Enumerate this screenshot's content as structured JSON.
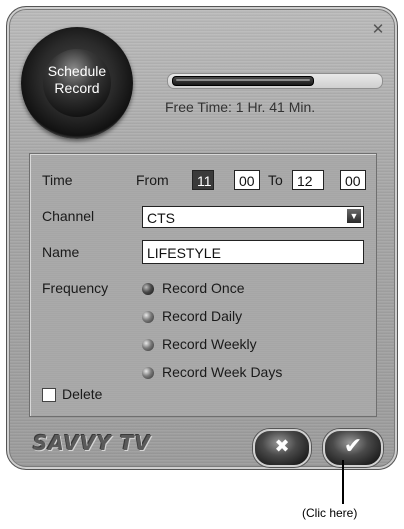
{
  "window": {
    "close_glyph": "✕"
  },
  "orb": {
    "label": "Schedule\nRecord"
  },
  "progress": {
    "fraction": 0.68
  },
  "status": {
    "free_time": "Free Time: 1 Hr. 41 Min."
  },
  "form": {
    "time_label": "Time",
    "from_label": "From",
    "from_hour": "11",
    "from_min": "00",
    "to_label": "To",
    "to_hour": "12",
    "to_min": "00",
    "channel_label": "Channel",
    "channel_value": "CTS",
    "name_label": "Name",
    "name_value": "LIFESTYLE",
    "frequency_label": "Frequency",
    "options": [
      "Record Once",
      "Record Daily",
      "Record Weekly",
      "Record Week Days"
    ],
    "delete_label": "Delete"
  },
  "footer": {
    "logo": "SAVVY TV",
    "cancel_glyph": "✖",
    "ok_glyph": "✔"
  },
  "annotation": {
    "text": "(Clic here)"
  },
  "icons": {
    "close": "close-icon",
    "dropdown": "chevron-down-icon",
    "cancel": "x-icon",
    "ok": "checkmark-icon"
  }
}
